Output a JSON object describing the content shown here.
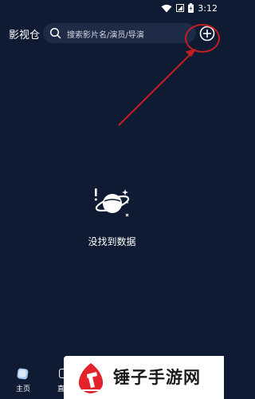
{
  "status_bar": {
    "time": "3:12"
  },
  "header": {
    "title": "影视仓",
    "search_placeholder": "搜索影片名/演员/导演"
  },
  "empty_state": {
    "message": "没找到数据"
  },
  "bottom_nav": {
    "home_label": "主页",
    "second_label": "直"
  },
  "watermark": {
    "text": "锤子手游网"
  },
  "colors": {
    "background": "#0e1b32",
    "search_bg": "#1d2b47",
    "annotation": "#c41e22",
    "watermark_brand": "#e3222b"
  }
}
